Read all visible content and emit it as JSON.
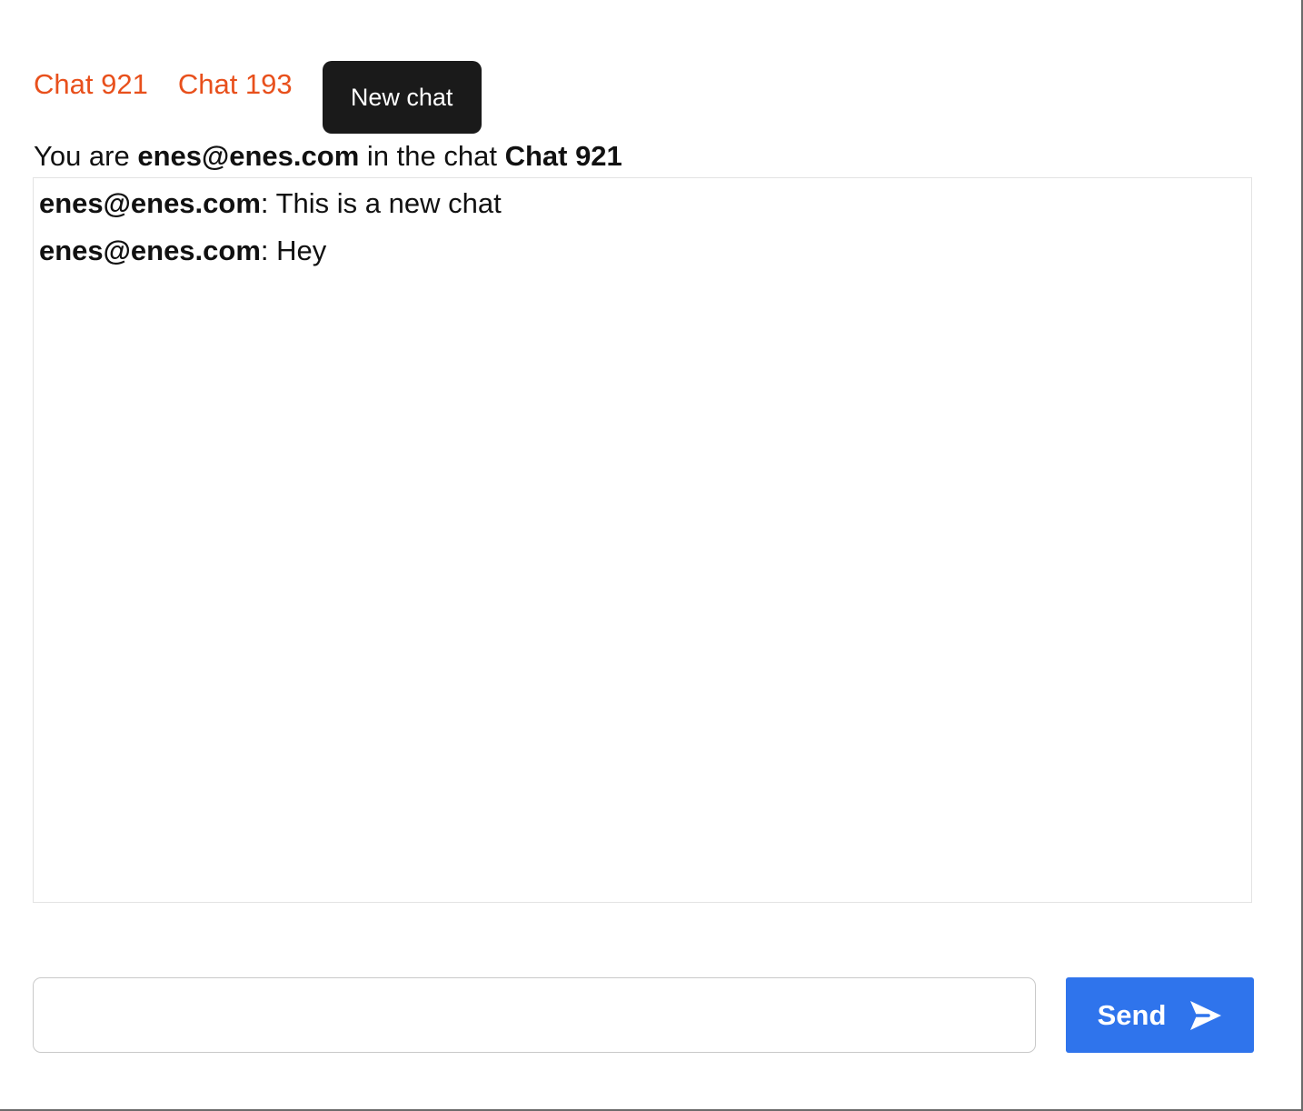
{
  "chats": [
    {
      "label": "Chat 921"
    },
    {
      "label": "Chat 193"
    }
  ],
  "new_chat_label": "New chat",
  "status": {
    "prefix": "You are",
    "user": "enes@enes.com",
    "middle": "in the chat",
    "chat_name": "Chat 921"
  },
  "messages": [
    {
      "author": "enes@enes.com",
      "separator": ":",
      "text": "This is a new chat"
    },
    {
      "author": "enes@enes.com",
      "separator": ":",
      "text": "Hey"
    }
  ],
  "composer": {
    "value": "",
    "placeholder": "",
    "send_label": "Send",
    "send_icon": "paper-plane-icon"
  },
  "colors": {
    "chat_link": "#e8501c",
    "new_chat_bg": "#1a1a1a",
    "send_bg": "#2f74ec"
  }
}
